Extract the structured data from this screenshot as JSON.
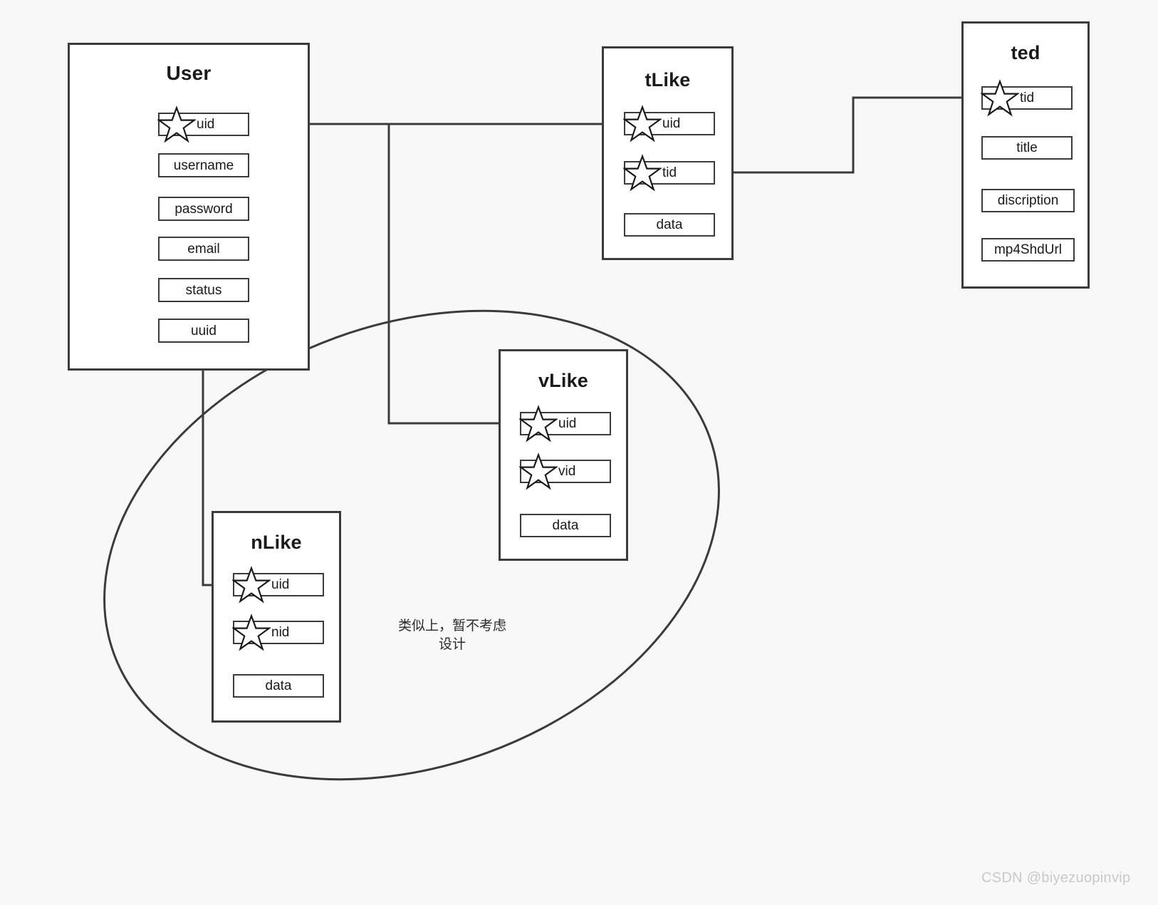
{
  "diagram": {
    "type": "entity-relationship-diagram",
    "background_color": "#f8f8f8",
    "line_color": "#3b3b3b",
    "box_fill": "#ffffff",
    "entities": [
      {
        "id": "user",
        "title": "User",
        "fields": [
          {
            "label": "uid",
            "key": true
          },
          {
            "label": "username",
            "key": false
          },
          {
            "label": "password",
            "key": false
          },
          {
            "label": "email",
            "key": false
          },
          {
            "label": "status",
            "key": false
          },
          {
            "label": "uuid",
            "key": false
          }
        ]
      },
      {
        "id": "tlike",
        "title": "tLike",
        "fields": [
          {
            "label": "uid",
            "key": true
          },
          {
            "label": "tid",
            "key": true
          },
          {
            "label": "data",
            "key": false
          }
        ]
      },
      {
        "id": "ted",
        "title": "ted",
        "fields": [
          {
            "label": "tid",
            "key": true
          },
          {
            "label": "title",
            "key": false
          },
          {
            "label": "discription",
            "key": false
          },
          {
            "label": "mp4ShdUrl",
            "key": false
          }
        ]
      },
      {
        "id": "vlike",
        "title": "vLike",
        "fields": [
          {
            "label": "uid",
            "key": true
          },
          {
            "label": "vid",
            "key": true
          },
          {
            "label": "data",
            "key": false
          }
        ]
      },
      {
        "id": "nlike",
        "title": "nLike",
        "fields": [
          {
            "label": "uid",
            "key": true
          },
          {
            "label": "nid",
            "key": true
          },
          {
            "label": "data",
            "key": false
          }
        ]
      }
    ],
    "relations": [
      {
        "from": "User.uid",
        "to": "tLike.uid"
      },
      {
        "from": "User.uid",
        "to": "vLike.uid"
      },
      {
        "from": "User.uid",
        "to": "nLike.uid"
      },
      {
        "from": "tLike.tid",
        "to": "ted.tid"
      }
    ],
    "annotation": {
      "text": "类似上，暂不考虑\n设计",
      "line1": "类似上，暂不考虑",
      "line2": "设计"
    },
    "group_label": "ellipse-grouping-vlike-nlike",
    "watermark": "CSDN @biyezuopinvip"
  }
}
